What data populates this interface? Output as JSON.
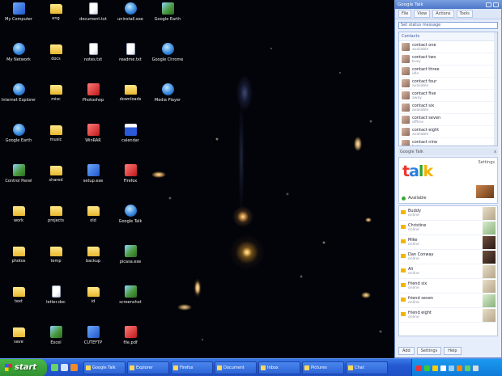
{
  "desktop": {
    "icons": [
      {
        "name": "desktop-icon-my-computer",
        "label": "My Computer",
        "type": "app",
        "col": 0,
        "row": 0
      },
      {
        "name": "desktop-icon-folder",
        "label": "eng",
        "type": "folder",
        "col": 1,
        "row": 0
      },
      {
        "name": "desktop-icon-doc",
        "label": "document.txt",
        "type": "doc",
        "col": 2,
        "row": 0
      },
      {
        "name": "desktop-icon-app",
        "label": "uninstall.exe",
        "type": "globe",
        "col": 3,
        "row": 0
      },
      {
        "name": "desktop-icon-app",
        "label": "Google Earth",
        "type": "pic",
        "col": 4,
        "row": 0
      },
      {
        "name": "desktop-icon-network",
        "label": "My Network",
        "type": "globe",
        "col": 0,
        "row": 1
      },
      {
        "name": "desktop-icon-folder",
        "label": "docs",
        "type": "folder",
        "col": 1,
        "row": 1
      },
      {
        "name": "desktop-icon-doc",
        "label": "notes.txt",
        "type": "doc",
        "col": 2,
        "row": 1
      },
      {
        "name": "desktop-icon-doc",
        "label": "readme.txt",
        "type": "doc",
        "col": 3,
        "row": 1
      },
      {
        "name": "desktop-icon-app",
        "label": "Google Chrome",
        "type": "globe",
        "col": 4,
        "row": 1
      },
      {
        "name": "desktop-icon-ie",
        "label": "Internet Explorer",
        "type": "globe",
        "col": 0,
        "row": 2
      },
      {
        "name": "desktop-icon-folder",
        "label": "misc",
        "type": "folder",
        "col": 1,
        "row": 2
      },
      {
        "name": "desktop-icon-app",
        "label": "Photoshop",
        "type": "red",
        "col": 2,
        "row": 2
      },
      {
        "name": "desktop-icon-folder",
        "label": "downloads",
        "type": "folder",
        "col": 3,
        "row": 2
      },
      {
        "name": "desktop-icon-app",
        "label": "Media Player",
        "type": "globe",
        "col": 4,
        "row": 2
      },
      {
        "name": "desktop-icon-app",
        "label": "Google Earth",
        "type": "globe",
        "col": 0,
        "row": 3
      },
      {
        "name": "desktop-icon-folder",
        "label": "music",
        "type": "folder",
        "col": 1,
        "row": 3
      },
      {
        "name": "desktop-icon-app",
        "label": "WinRAR",
        "type": "red",
        "col": 2,
        "row": 3
      },
      {
        "name": "desktop-icon-app",
        "label": "calendar",
        "type": "win",
        "col": 3,
        "row": 3
      },
      {
        "name": "desktop-icon-app",
        "label": "Control Panel",
        "type": "pic",
        "col": 0,
        "row": 4
      },
      {
        "name": "desktop-icon-folder",
        "label": "shared",
        "type": "folder",
        "col": 1,
        "row": 4
      },
      {
        "name": "desktop-icon-app",
        "label": "setup.exe",
        "type": "app",
        "col": 2,
        "row": 4
      },
      {
        "name": "desktop-icon-app",
        "label": "Firefox",
        "type": "red",
        "col": 3,
        "row": 4
      },
      {
        "name": "desktop-icon-folder",
        "label": "work",
        "type": "folder",
        "col": 0,
        "row": 5
      },
      {
        "name": "desktop-icon-folder",
        "label": "projects",
        "type": "folder",
        "col": 1,
        "row": 5
      },
      {
        "name": "desktop-icon-folder",
        "label": "old",
        "type": "folder",
        "col": 2,
        "row": 5
      },
      {
        "name": "desktop-icon-app",
        "label": "Google Talk",
        "type": "globe",
        "col": 3,
        "row": 5
      },
      {
        "name": "desktop-icon-folder",
        "label": "photos",
        "type": "folder",
        "col": 0,
        "row": 6
      },
      {
        "name": "desktop-icon-folder",
        "label": "temp",
        "type": "folder",
        "col": 1,
        "row": 6
      },
      {
        "name": "desktop-icon-folder",
        "label": "backup",
        "type": "folder",
        "col": 2,
        "row": 6
      },
      {
        "name": "desktop-icon-app",
        "label": "picasa.exe",
        "type": "pic",
        "col": 3,
        "row": 6
      },
      {
        "name": "desktop-icon-folder",
        "label": "text",
        "type": "folder",
        "col": 0,
        "row": 7
      },
      {
        "name": "desktop-icon-doc",
        "label": "letter.doc",
        "type": "doc",
        "col": 1,
        "row": 7
      },
      {
        "name": "desktop-icon-folder",
        "label": "id",
        "type": "folder",
        "col": 2,
        "row": 7
      },
      {
        "name": "desktop-icon-app",
        "label": "screenshot",
        "type": "pic",
        "col": 3,
        "row": 7
      },
      {
        "name": "desktop-icon-folder",
        "label": "save",
        "type": "folder",
        "col": 0,
        "row": 8
      },
      {
        "name": "desktop-icon-app",
        "label": "Excel",
        "type": "pic",
        "col": 1,
        "row": 8
      },
      {
        "name": "desktop-icon-app",
        "label": "CUTEFTP",
        "type": "app",
        "col": 2,
        "row": 8
      },
      {
        "name": "desktop-icon-doc",
        "label": "file.pdf",
        "type": "red",
        "col": 3,
        "row": 8
      }
    ]
  },
  "gtalk": {
    "title": "Google Talk",
    "menu": [
      "File",
      "View",
      "Actions",
      "Tools"
    ],
    "status_input": "Set status message",
    "contacts_header": "Contacts",
    "contacts": [
      {
        "name": "contact one",
        "sub": "available"
      },
      {
        "name": "contact two",
        "sub": "busy"
      },
      {
        "name": "contact three",
        "sub": "idle"
      },
      {
        "name": "contact four",
        "sub": "available"
      },
      {
        "name": "contact five",
        "sub": "away"
      },
      {
        "name": "contact six",
        "sub": "available"
      },
      {
        "name": "contact seven",
        "sub": "offline"
      },
      {
        "name": "contact eight",
        "sub": "available"
      },
      {
        "name": "contact nine",
        "sub": "busy"
      }
    ],
    "section_label": "Google Talk",
    "section_right": "x",
    "ad": {
      "logo": [
        "t",
        "a",
        "l",
        "k"
      ],
      "top_right": "Settings",
      "me_name": "Available",
      "me_sub": "status"
    },
    "friends": [
      {
        "name": "Buddy",
        "sub": "online",
        "pic": "light"
      },
      {
        "name": "Christine",
        "sub": "online",
        "pic": "green"
      },
      {
        "name": "Mike",
        "sub": "online",
        "pic": "dark"
      },
      {
        "name": "Dan Conway",
        "sub": "online",
        "pic": "dark"
      },
      {
        "name": "Ali",
        "sub": "online",
        "pic": "light"
      },
      {
        "name": "friend six",
        "sub": "online",
        "pic": "light"
      },
      {
        "name": "friend seven",
        "sub": "online",
        "pic": "green"
      },
      {
        "name": "friend eight",
        "sub": "online",
        "pic": "light"
      }
    ],
    "footer": [
      "Add",
      "Settings",
      "Help"
    ]
  },
  "taskbar": {
    "start_label": "start",
    "tasks": [
      "Google Talk",
      "Explorer",
      "Firefox",
      "Document",
      "Inbox",
      "Pictures",
      "Chat"
    ]
  }
}
